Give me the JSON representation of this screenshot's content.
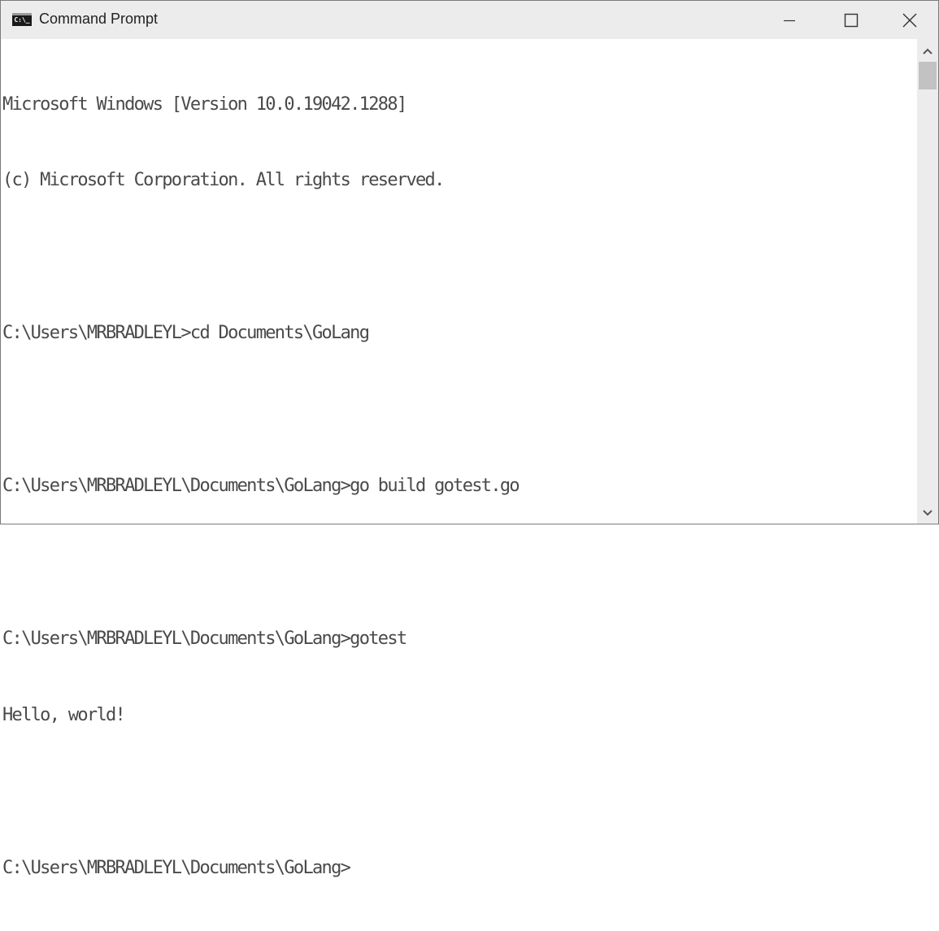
{
  "window": {
    "title": "Command Prompt",
    "icon": "cmd-icon",
    "icon_text": "C:\\_",
    "controls": {
      "minimize": "minimize-icon",
      "maximize": "maximize-icon",
      "close": "close-icon"
    }
  },
  "console": {
    "lines": [
      "Microsoft Windows [Version 10.0.19042.1288]",
      "(c) Microsoft Corporation. All rights reserved.",
      "",
      "C:\\Users\\MRBRADLEYL>cd Documents\\GoLang",
      "",
      "C:\\Users\\MRBRADLEYL\\Documents\\GoLang>go build gotest.go",
      "",
      "C:\\Users\\MRBRADLEYL\\Documents\\GoLang>gotest",
      "Hello, world!",
      "",
      "C:\\Users\\MRBRADLEYL\\Documents\\GoLang>"
    ]
  },
  "scrollbar": {
    "up": "chevron-up-icon",
    "down": "chevron-down-icon"
  }
}
